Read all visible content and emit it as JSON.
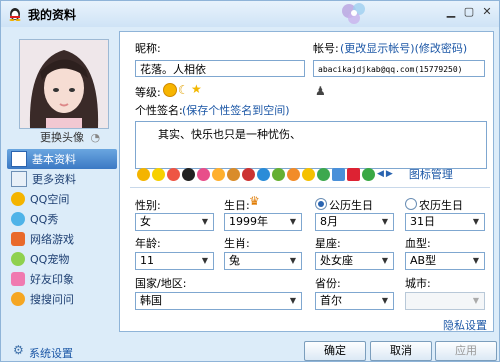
{
  "window": {
    "title": "我的资料"
  },
  "left": {
    "change_avatar": "更换头像",
    "nav": [
      {
        "label": "基本资料",
        "active": true
      },
      {
        "label": "更多资料"
      },
      {
        "label": "QQ空间"
      },
      {
        "label": "QQ秀"
      },
      {
        "label": "网络游戏"
      },
      {
        "label": "QQ宠物"
      },
      {
        "label": "好友印象"
      },
      {
        "label": "搜搜问问"
      }
    ],
    "system_settings": "系统设置"
  },
  "form": {
    "nickname_label": "昵称:",
    "nickname_value": "花落。人相依",
    "account_label": "帐号:",
    "account_links": "(更改显示帐号)(修改密码)",
    "account_value": "abacikajdjkab@qq.com(15779250)",
    "level_label": "等级:",
    "signature_label": "个性签名:",
    "signature_link": "(保存个性签名到空间)",
    "signature_value": "其实、快乐也只是一种忧伤、",
    "icon_manage": "图标管理",
    "gender_label": "性别:",
    "gender_value": "女",
    "birthday_label": "生日:",
    "year_value": "1999年",
    "month_value": "8月",
    "day_value": "31日",
    "solar_label": "公历生日",
    "lunar_label": "农历生日",
    "age_label": "年龄:",
    "age_value": "11",
    "zodiac_label": "生肖:",
    "zodiac_value": "兔",
    "constellation_label": "星座:",
    "constellation_value": "处女座",
    "blood_label": "血型:",
    "blood_value": "AB型",
    "country_label": "国家/地区:",
    "country_value": "韩国",
    "province_label": "省份:",
    "province_value": "首尔",
    "city_label": "城市:",
    "city_value": "",
    "privacy_link": "隐私设置"
  },
  "buttons": {
    "ok": "确定",
    "cancel": "取消",
    "apply": "应用"
  },
  "colors": {
    "accent": "#3b79c4",
    "link": "#1c57a6",
    "window_bg": "#dcecf9",
    "border": "#8fb4d8"
  }
}
